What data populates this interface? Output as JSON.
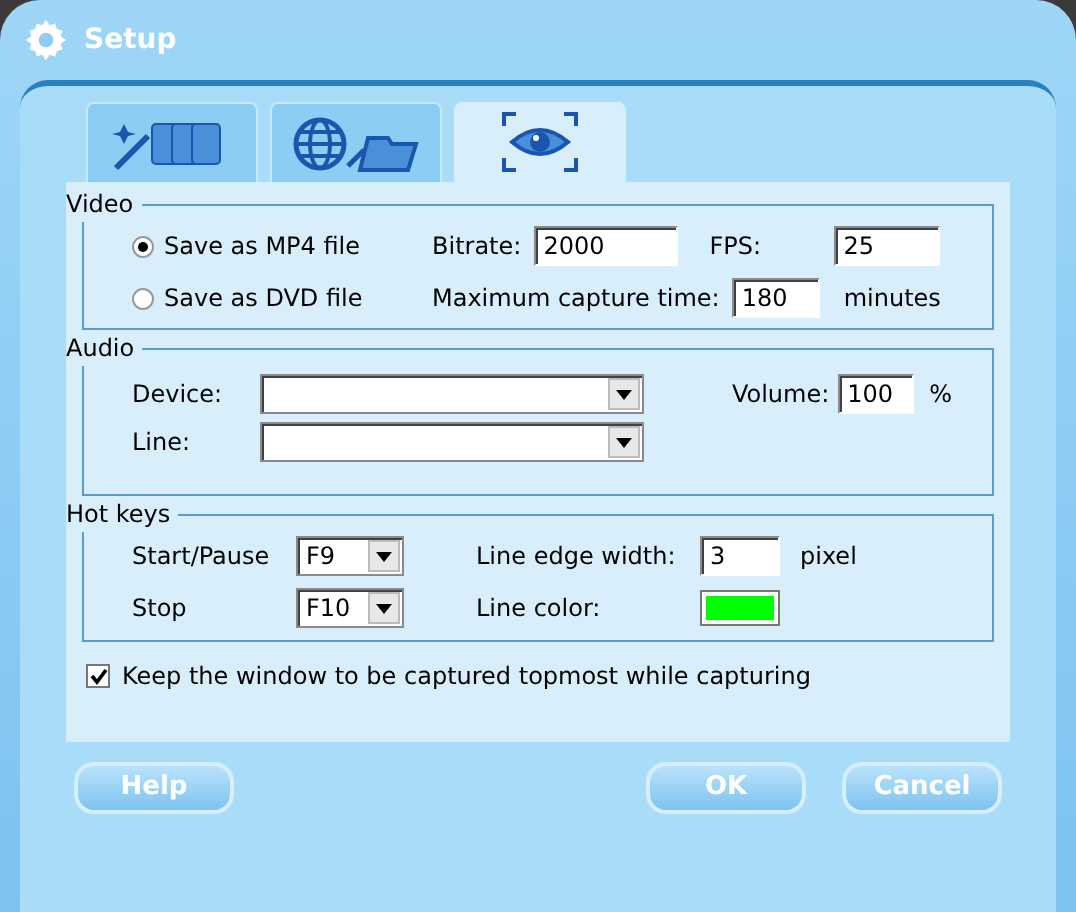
{
  "window": {
    "title": "Setup"
  },
  "tabs": [
    {
      "kind": "wand",
      "selected": false
    },
    {
      "kind": "globe",
      "selected": false
    },
    {
      "kind": "eye",
      "selected": true
    }
  ],
  "video": {
    "title": "Video",
    "formats": [
      {
        "label": "Save as MP4 file",
        "selected": true
      },
      {
        "label": "Save as DVD file",
        "selected": false
      }
    ],
    "bitrate": {
      "label": "Bitrate:",
      "value": "2000"
    },
    "fps": {
      "label": "FPS:",
      "value": "25"
    },
    "max_capture": {
      "label": "Maximum capture time:",
      "value": "180",
      "unit": "minutes"
    }
  },
  "audio": {
    "title": "Audio",
    "device": {
      "label": "Device:"
    },
    "line": {
      "label": "Line:"
    },
    "volume": {
      "label": "Volume:",
      "value": "100",
      "unit": "%"
    }
  },
  "hot_keys": {
    "title": "Hot keys",
    "start_pause": {
      "label": "Start/Pause",
      "value": "F9"
    },
    "stop": {
      "label": "Stop",
      "value": "F10"
    },
    "line_edge_width": {
      "label": "Line edge width:",
      "value": "3",
      "unit": "pixel"
    },
    "line_color": {
      "label": "Line color:",
      "color": "#00ff00"
    }
  },
  "topmost": {
    "label": "Keep the window to be captured topmost while capturing",
    "checked": true
  },
  "buttons": [
    "Help",
    "OK",
    "Cancel"
  ]
}
